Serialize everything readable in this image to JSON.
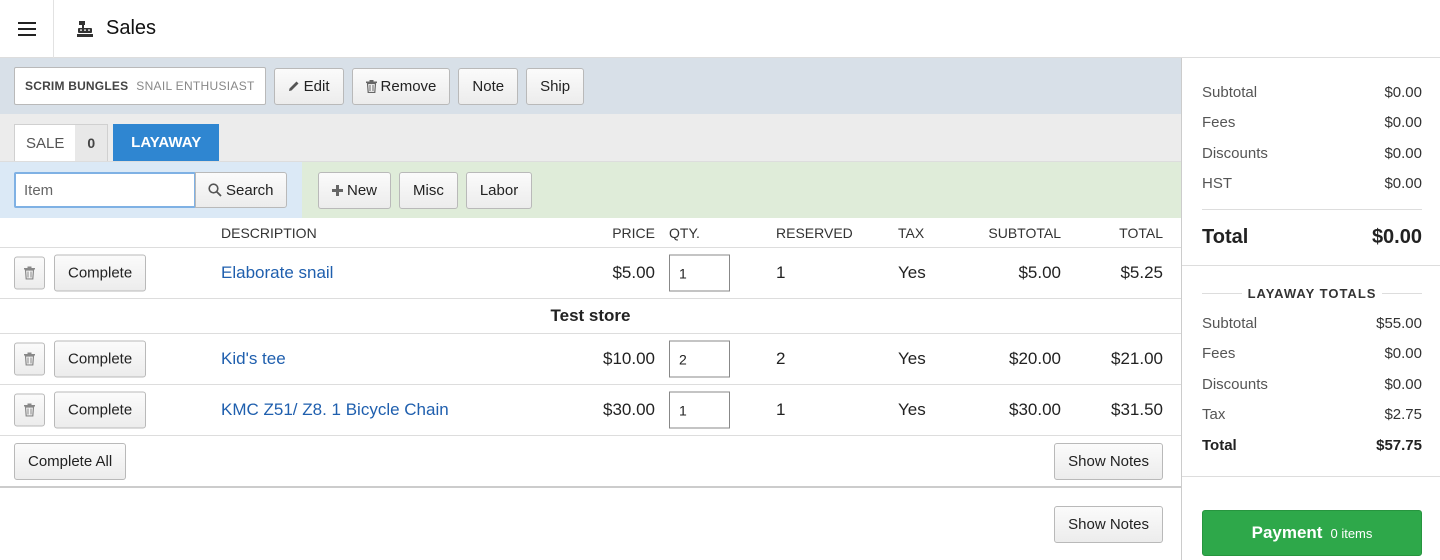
{
  "header": {
    "title": "Sales",
    "menu_icon": "hamburger-icon",
    "title_icon": "cash-register-icon"
  },
  "customer": {
    "name": "SCRIM BUNGLES",
    "title": "SNAIL ENTHUSIAST"
  },
  "toolbar": {
    "edit": "Edit",
    "remove": "Remove",
    "note": "Note",
    "ship": "Ship"
  },
  "tabs": {
    "sale_label": "SALE",
    "sale_count": "0",
    "layaway_label": "LAYAWAY"
  },
  "item_bar": {
    "placeholder": "Item",
    "search": "Search",
    "new": "New",
    "misc": "Misc",
    "labor": "Labor"
  },
  "columns": {
    "description": "DESCRIPTION",
    "price": "PRICE",
    "qty": "QTY.",
    "reserved": "RESERVED",
    "tax": "TAX",
    "subtotal": "SUBTOTAL",
    "total": "TOTAL"
  },
  "rows": [
    {
      "complete": "Complete",
      "description": "Elaborate snail",
      "price": "$5.00",
      "qty": "1",
      "reserved": "1",
      "tax": "Yes",
      "subtotal": "$5.00",
      "total": "$5.25"
    },
    {
      "complete": "Complete",
      "description": "Kid's tee",
      "price": "$10.00",
      "qty": "2",
      "reserved": "2",
      "tax": "Yes",
      "subtotal": "$20.00",
      "total": "$21.00"
    },
    {
      "complete": "Complete",
      "description": "KMC Z51/ Z8. 1 Bicycle Chain",
      "price": "$30.00",
      "qty": "1",
      "reserved": "1",
      "tax": "Yes",
      "subtotal": "$30.00",
      "total": "$31.50"
    }
  ],
  "store_group": "Test store",
  "footer": {
    "complete_all": "Complete All",
    "show_notes": "Show Notes",
    "show_notes_bottom": "Show Notes"
  },
  "summary": {
    "subtotal_label": "Subtotal",
    "subtotal": "$0.00",
    "fees_label": "Fees",
    "fees": "$0.00",
    "discounts_label": "Discounts",
    "discounts": "$0.00",
    "hst_label": "HST",
    "hst": "$0.00",
    "total_label": "Total",
    "total": "$0.00"
  },
  "layaway_totals": {
    "heading": "LAYAWAY TOTALS",
    "subtotal_label": "Subtotal",
    "subtotal": "$55.00",
    "fees_label": "Fees",
    "fees": "$0.00",
    "discounts_label": "Discounts",
    "discounts": "$0.00",
    "tax_label": "Tax",
    "tax": "$2.75",
    "total_label": "Total",
    "total": "$57.75"
  },
  "payment": {
    "label": "Payment",
    "count": "0 items"
  },
  "colors": {
    "accent": "#2f86d1",
    "link": "#1f5fae",
    "pay": "#2ea84a"
  }
}
